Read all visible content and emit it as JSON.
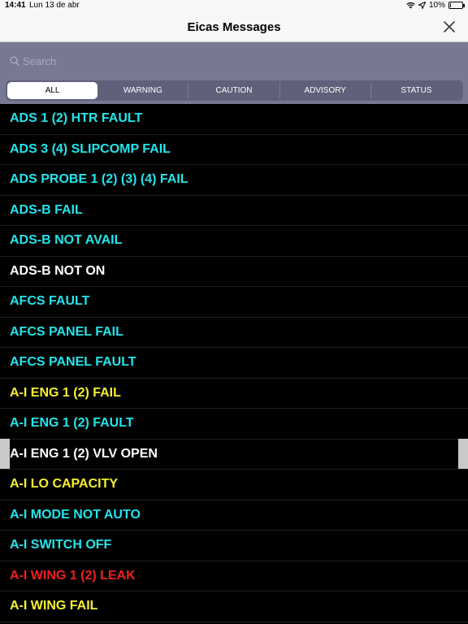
{
  "statusbar": {
    "time": "14:41",
    "date": "Lun 13 de abr",
    "battery": "10%",
    "battery_level": 0.1
  },
  "navbar": {
    "title": "Eicas Messages",
    "close_icon": "close-icon"
  },
  "search": {
    "placeholder": "Search",
    "value": ""
  },
  "filters": {
    "selected": "ALL",
    "items": [
      {
        "label": "ALL"
      },
      {
        "label": "WARNING"
      },
      {
        "label": "CAUTION"
      },
      {
        "label": "ADVISORY"
      },
      {
        "label": "STATUS"
      }
    ]
  },
  "colors": {
    "advisory": "#22e5eb",
    "status": "#ffffff",
    "caution": "#f5f02c",
    "warning": "#f01e1e",
    "background": "#000000",
    "search_bar": "#777891"
  },
  "messages": [
    {
      "text": "ADS 1 (2) HTR FAULT",
      "level": "advisory"
    },
    {
      "text": "ADS 3 (4) SLIPCOMP FAIL",
      "level": "advisory"
    },
    {
      "text": "ADS PROBE 1 (2) (3) (4) FAIL",
      "level": "advisory"
    },
    {
      "text": "ADS-B FAIL",
      "level": "advisory"
    },
    {
      "text": "ADS-B NOT AVAIL",
      "level": "advisory"
    },
    {
      "text": "ADS-B NOT ON",
      "level": "status"
    },
    {
      "text": "AFCS FAULT",
      "level": "advisory"
    },
    {
      "text": "AFCS PANEL FAIL",
      "level": "advisory"
    },
    {
      "text": "AFCS PANEL FAULT",
      "level": "advisory"
    },
    {
      "text": "A-I ENG 1 (2) FAIL",
      "level": "caution"
    },
    {
      "text": "A-I ENG 1 (2) FAULT",
      "level": "advisory"
    },
    {
      "text": "A-I ENG 1 (2) VLV OPEN",
      "level": "status"
    },
    {
      "text": "A-I LO CAPACITY",
      "level": "caution"
    },
    {
      "text": "A-I MODE NOT AUTO",
      "level": "advisory"
    },
    {
      "text": "A-I SWITCH OFF",
      "level": "advisory"
    },
    {
      "text": "A-I WING 1 (2) LEAK",
      "level": "warning"
    },
    {
      "text": "A-I WING FAIL",
      "level": "caution"
    }
  ]
}
